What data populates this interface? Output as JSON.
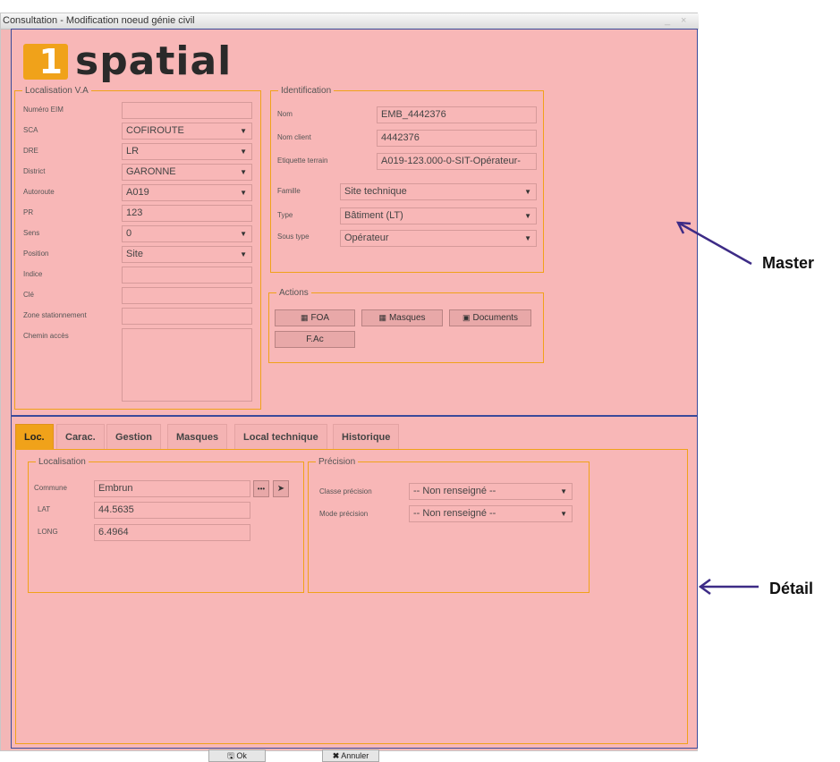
{
  "window": {
    "title": "Consultation - Modification noeud génie civil",
    "close": "×",
    "minimize": "_"
  },
  "logo": {
    "digit": "1",
    "word": "spatial"
  },
  "localisation_va": {
    "legend": "Localisation V.A",
    "fields": [
      {
        "label": "Numéro EIM",
        "value": "",
        "dropdown": false
      },
      {
        "label": "SCA",
        "value": "COFIROUTE",
        "dropdown": true
      },
      {
        "label": "DRE",
        "value": "LR",
        "dropdown": true
      },
      {
        "label": "District",
        "value": "GARONNE",
        "dropdown": true
      },
      {
        "label": "Autoroute",
        "value": "A019",
        "dropdown": true
      },
      {
        "label": "PR",
        "value": "123",
        "dropdown": false
      },
      {
        "label": "Sens",
        "value": "0",
        "dropdown": true
      },
      {
        "label": "Position",
        "value": "Site",
        "dropdown": true
      },
      {
        "label": "Indice",
        "value": "",
        "dropdown": false
      },
      {
        "label": "Clé",
        "value": "",
        "dropdown": false
      },
      {
        "label": "Zone stationnement",
        "value": "",
        "dropdown": false
      },
      {
        "label": "Chemin accès",
        "value": "",
        "dropdown": false
      }
    ]
  },
  "identification": {
    "legend": "Identification",
    "nom": {
      "label": "Nom",
      "value": "EMB_4442376"
    },
    "nom_client": {
      "label": "Nom client",
      "value": "4442376"
    },
    "etiquette": {
      "label": "Etiquette terrain",
      "value": "A019-123.000-0-SIT-Opérateur-"
    },
    "famille": {
      "label": "Famille",
      "value": "Site technique"
    },
    "type": {
      "label": "Type",
      "value": "Bâtiment (LT)"
    },
    "sous_type": {
      "label": "Sous type",
      "value": "Opérateur"
    }
  },
  "actions": {
    "legend": "Actions",
    "foa": "FOA",
    "masques": "Masques",
    "documents": "Documents",
    "fac": "F.Ac"
  },
  "tabs": [
    "Loc.",
    "Carac.",
    "Gestion",
    "Masques",
    "Local technique",
    "Historique"
  ],
  "localisation": {
    "legend": "Localisation",
    "commune": {
      "label": "Commune",
      "value": "Embrun"
    },
    "lat": {
      "label": "LAT",
      "value": "44.5635"
    },
    "long": {
      "label": "LONG",
      "value": "6.4964"
    },
    "more": "•••",
    "pointer": "➤"
  },
  "precision": {
    "legend": "Précision",
    "classe": {
      "label": "Classe précision",
      "value": "-- Non renseigné --"
    },
    "mode": {
      "label": "Mode précision",
      "value": "-- Non renseigné --"
    }
  },
  "footer": {
    "ok": "Ok",
    "annuler": "Annuler"
  },
  "annotations": {
    "master": "Master",
    "detail": "Détail"
  }
}
